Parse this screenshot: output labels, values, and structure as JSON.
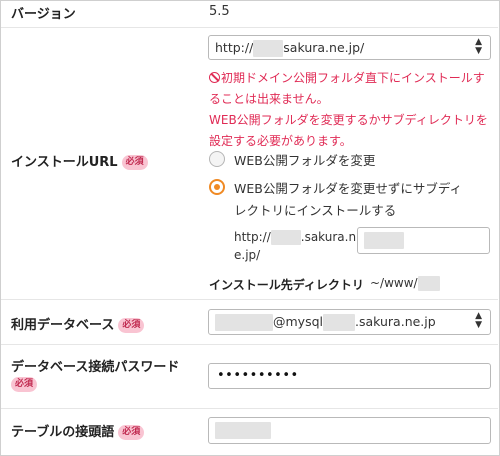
{
  "version": {
    "label": "バージョン",
    "value": "5.5"
  },
  "required_badge": "必須",
  "install_url": {
    "label": "インストールURL",
    "domain_select": {
      "prefix": "http://",
      "suffix": "sakura.ne.jp/"
    },
    "error_line1": "初期ドメイン公開フォルダ直下にインストールす",
    "error_line2": "ることは出来ません。",
    "error_line3": "WEB公開フォルダを変更するかサブディレクトリを",
    "error_line4": "設定する必要があります。",
    "option1": "WEB公開フォルダを変更",
    "option2_line1": "WEB公開フォルダを変更せずにサブディ",
    "option2_line2": "レクトリにインストールする",
    "url_line1_prefix": "http://",
    "url_line1_suffix": ".sakura.n",
    "url_line2": "e.jp/",
    "dest_label": "インストール先ディレクトリ",
    "dest_value": "~/www/"
  },
  "database": {
    "label": "利用データベース",
    "select_middle": "@mysql",
    "select_suffix": ".sakura.ne.jp"
  },
  "db_password": {
    "label": "データベース接続パスワード",
    "masked_value": "••••••••••"
  },
  "table_prefix": {
    "label": "テーブルの接頭語"
  }
}
